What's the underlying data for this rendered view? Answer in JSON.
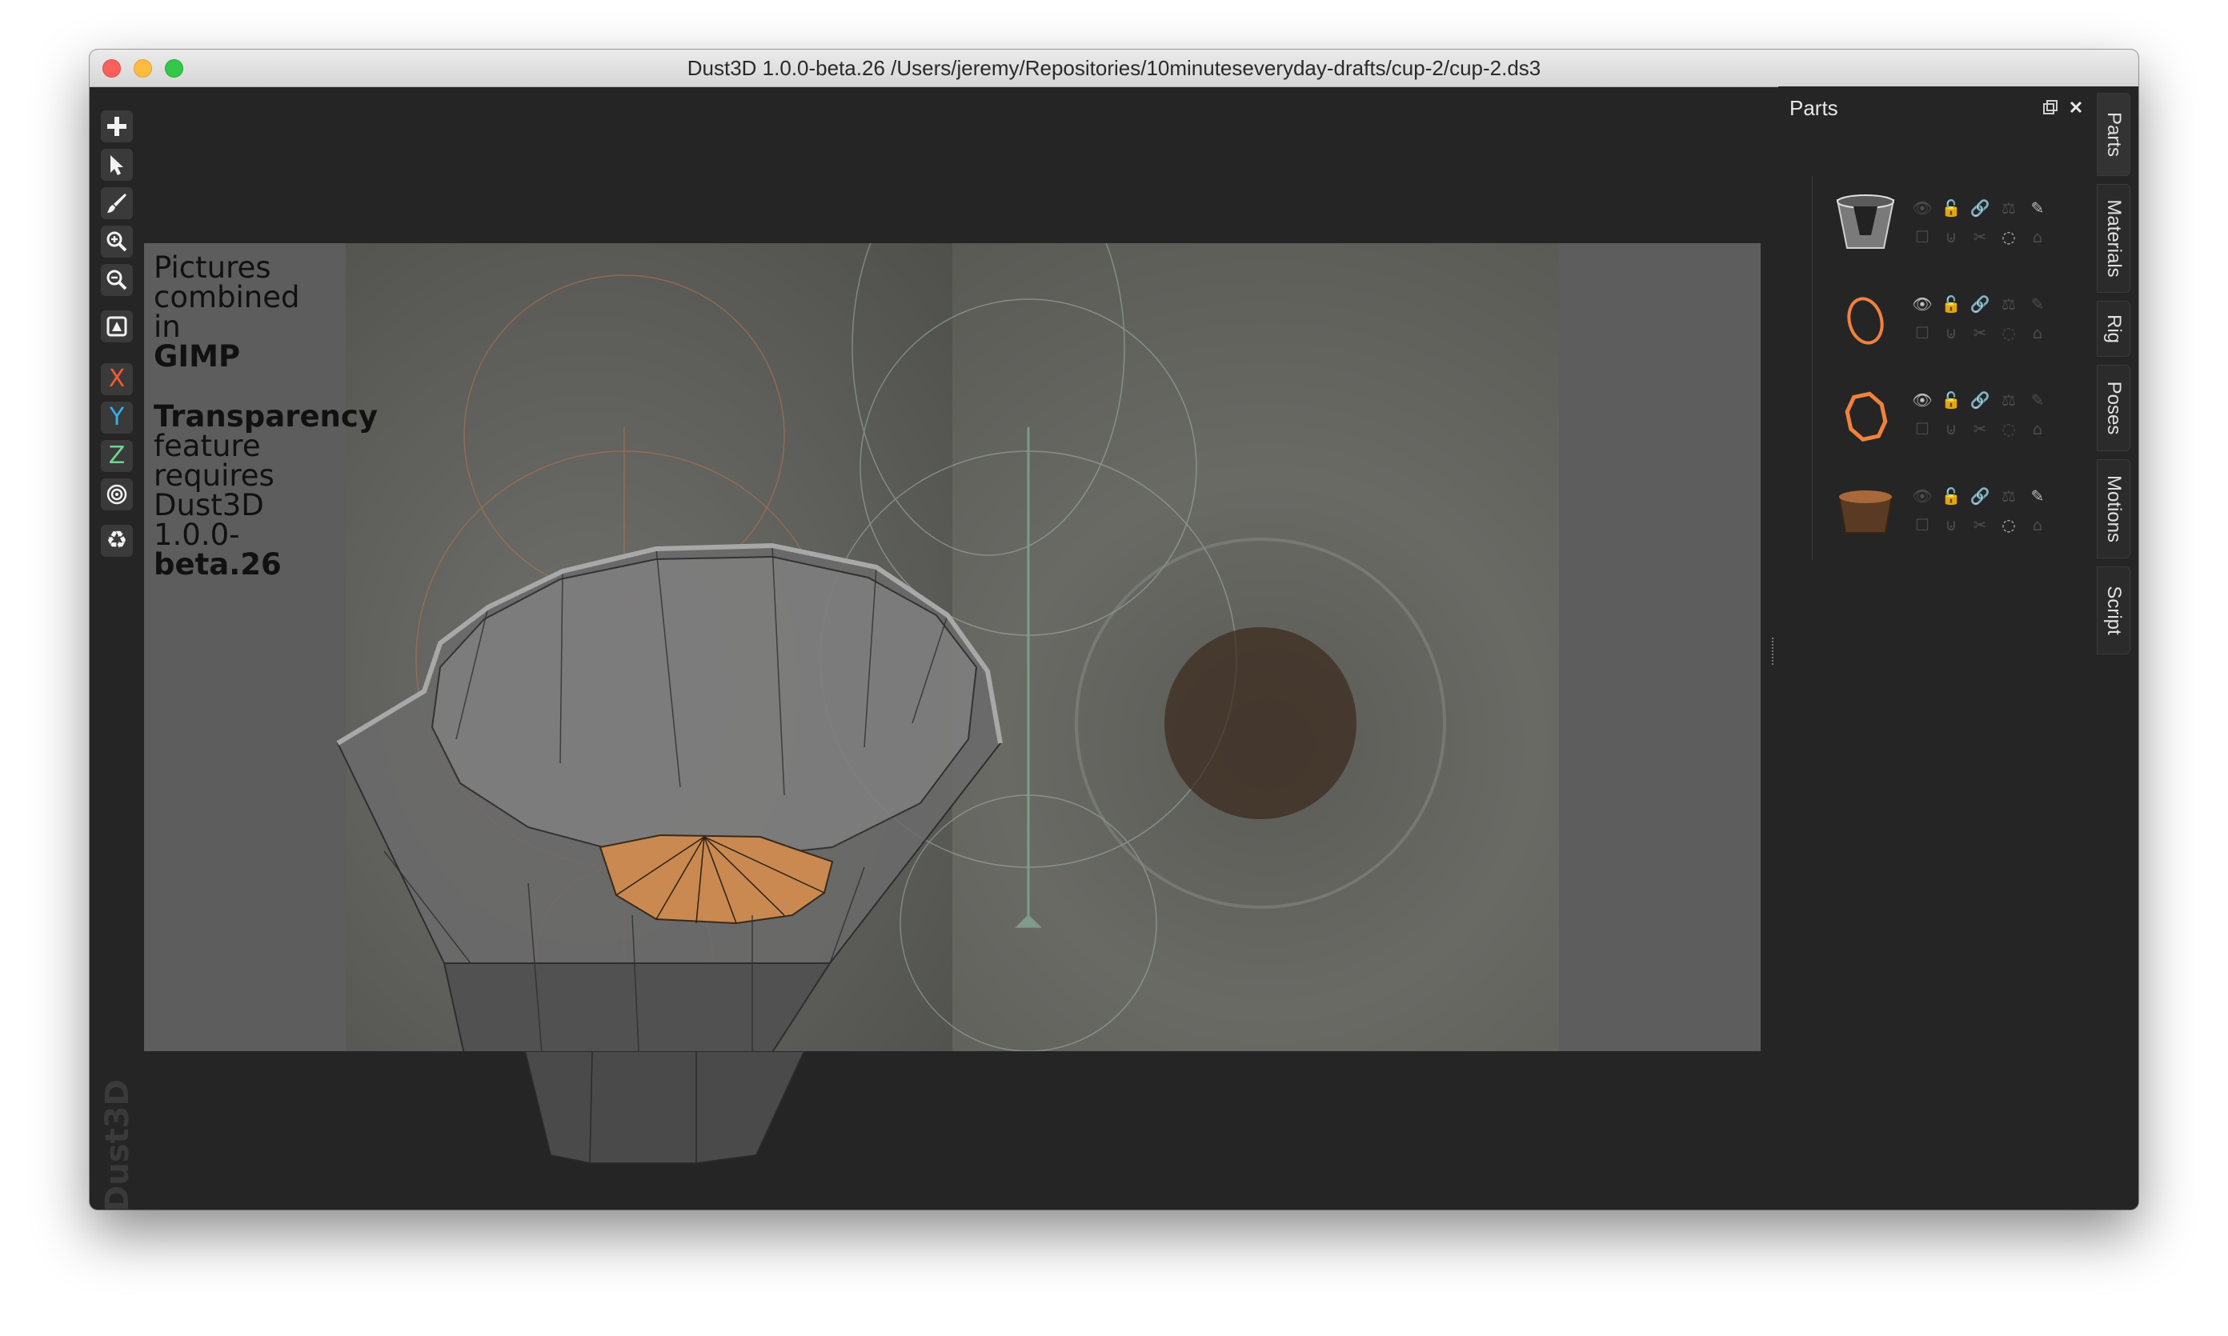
{
  "window": {
    "title": "Dust3D 1.0.0-beta.26 /Users/jeremy/Repositories/10minuteseveryday-drafts/cup-2/cup-2.ds3"
  },
  "toolbar": {
    "tools": [
      {
        "name": "add-icon",
        "glyph": "+"
      },
      {
        "name": "select-icon",
        "glyph": "➤"
      },
      {
        "name": "paint-icon",
        "glyph": "✎"
      },
      {
        "name": "zoom-in-icon",
        "glyph": "⊕"
      },
      {
        "name": "zoom-out-icon",
        "glyph": "⊖"
      },
      {
        "name": "camera-icon",
        "glyph": "▣"
      },
      {
        "name": "x-axis",
        "glyph": "X"
      },
      {
        "name": "y-axis",
        "glyph": "Y"
      },
      {
        "name": "z-axis",
        "glyph": "Z"
      },
      {
        "name": "radius-icon",
        "glyph": "◎"
      },
      {
        "name": "recycle-icon",
        "glyph": "♻"
      }
    ],
    "axis_colors": {
      "x": "#f95a2c",
      "y": "#30b3e8",
      "z": "#72d48e"
    }
  },
  "canvas": {
    "note_line1": "Pictures",
    "note_line2": "combined",
    "note_line3": "in",
    "note_line4": "GIMP",
    "note_line5": "Transparency",
    "note_line6": "feature",
    "note_line7": "requires",
    "note_line8": "Dust3D",
    "note_line9": "1.0.0-",
    "note_line10": "beta.26"
  },
  "parts_panel": {
    "title": "Parts",
    "float_icon": "float-icon",
    "close_icon": "close-icon",
    "parts": [
      {
        "thumb": "glass-cup-part",
        "visible": false
      },
      {
        "thumb": "orange-ring-part",
        "visible": true
      },
      {
        "thumb": "orange-octagon-part",
        "visible": true
      },
      {
        "thumb": "brown-cup-base-part",
        "visible": false
      }
    ]
  },
  "side_tabs": [
    "Parts",
    "Materials",
    "Rig",
    "Poses",
    "Motions",
    "Script"
  ],
  "watermark": "Dust3D",
  "colors": {
    "accent_orange": "#f0823c",
    "panel_bg": "#252525"
  }
}
